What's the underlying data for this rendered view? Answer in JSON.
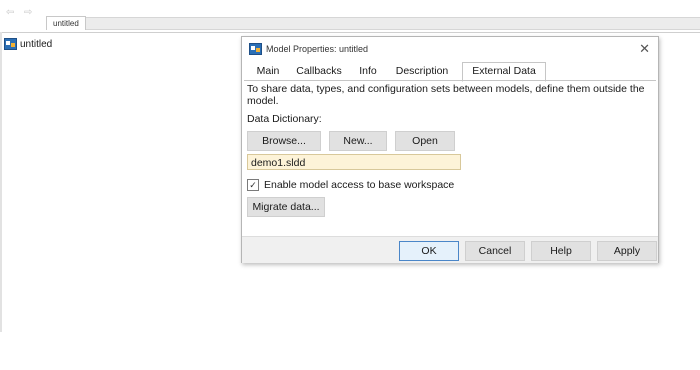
{
  "breadcrumb": {
    "tab_label": "untitled"
  },
  "editor": {
    "model_label": "untitled"
  },
  "dialog": {
    "title": "Model Properties: untitled",
    "tabs": [
      {
        "label": "Main",
        "active": false
      },
      {
        "label": "Callbacks",
        "active": false
      },
      {
        "label": "Info",
        "active": false
      },
      {
        "label": "Description",
        "active": false
      },
      {
        "label": "External Data",
        "active": true
      }
    ],
    "description": "To share data, types, and configuration sets between models, define them outside the model.",
    "data_dictionary_label": "Data Dictionary:",
    "buttons": {
      "browse": "Browse...",
      "new": "New...",
      "open": "Open"
    },
    "data_dictionary_value": "demo1.sldd",
    "enable_base_workspace": {
      "label": "Enable model access to base workspace",
      "checked": true
    },
    "migrate_button": "Migrate data...",
    "footer": {
      "ok": "OK",
      "cancel": "Cancel",
      "help": "Help",
      "apply": "Apply"
    }
  },
  "icons": {
    "back": "back-arrow-icon",
    "forward": "forward-arrow-icon",
    "model": "simulink-model-icon",
    "close": "close-icon",
    "check": "checkmark-icon"
  },
  "colors": {
    "field_bg": "#fdf3d8",
    "button_bg": "#e1e1e1",
    "ok_border": "#4a86c8"
  }
}
